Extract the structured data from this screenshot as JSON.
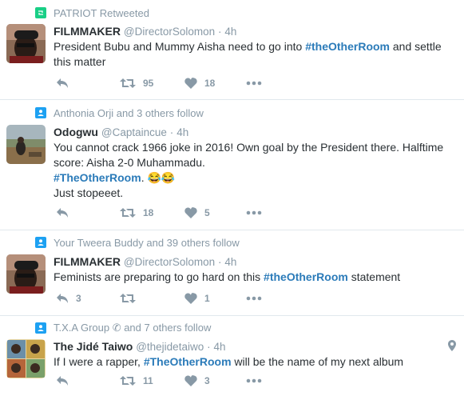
{
  "colors": {
    "accent": "#2b7bb9",
    "muted": "#8899a6",
    "text": "#292f33",
    "retweet_green": "#19cf86",
    "follow_blue": "#1da1f2"
  },
  "tweets": [
    {
      "context_icon": "retweet-context-icon",
      "context": "PATRIOT Retweeted",
      "name": "FILMMAKER",
      "handle": "@DirectorSolomon",
      "dot": "·",
      "time": "4h",
      "text_lines": [
        [
          "President Bubu and Mummy Aisha need to go into ",
          "#theOtherRoom",
          " and settle"
        ],
        [
          "this matter"
        ]
      ],
      "reply_count": "",
      "retweet_count": "95",
      "like_count": "18"
    },
    {
      "context_icon": "follow-context-icon",
      "context": "Anthonia Orji and 3 others follow",
      "name": "Odogwu",
      "handle": "@Captaincue",
      "dot": "·",
      "time": "4h",
      "line1": "You cannot crack 1966 joke in 2016! Own goal by the President there. Halftime",
      "line2": "score: Aisha 2-0 Muhammadu.",
      "hashtag": "#TheOtherRoom",
      "after_hashtag": ". 😂😂",
      "line4": "Just stopeeet.",
      "reply_count": "",
      "retweet_count": "18",
      "like_count": "5"
    },
    {
      "context_icon": "follow-context-icon",
      "context": "Your Tweera Buddy and 39 others follow",
      "name": "FILMMAKER",
      "handle": "@DirectorSolomon",
      "dot": "·",
      "time": "4h",
      "before": "Feminists are preparing to go hard on this ",
      "hashtag": "#theOtherRoom",
      "after": " statement",
      "reply_count": "3",
      "retweet_count": "",
      "like_count": "1"
    },
    {
      "context_icon": "follow-context-icon",
      "context": "T.X.A Group ✆ and 7 others follow",
      "name": "The Jidé Taiwo",
      "handle": "@thejidetaiwo",
      "dot": "·",
      "time": "4h",
      "before": "If I were a rapper, ",
      "hashtag": "#TheOtherRoom",
      "after": " will be the name of my next album",
      "reply_count": "",
      "retweet_count": "11",
      "like_count": "3"
    }
  ],
  "t1_line1_a": "President Bubu and Mummy Aisha need to go into ",
  "t1_line1_b": "#theOtherRoom",
  "t1_line1_c": " and settle",
  "t1_line2": "this matter"
}
